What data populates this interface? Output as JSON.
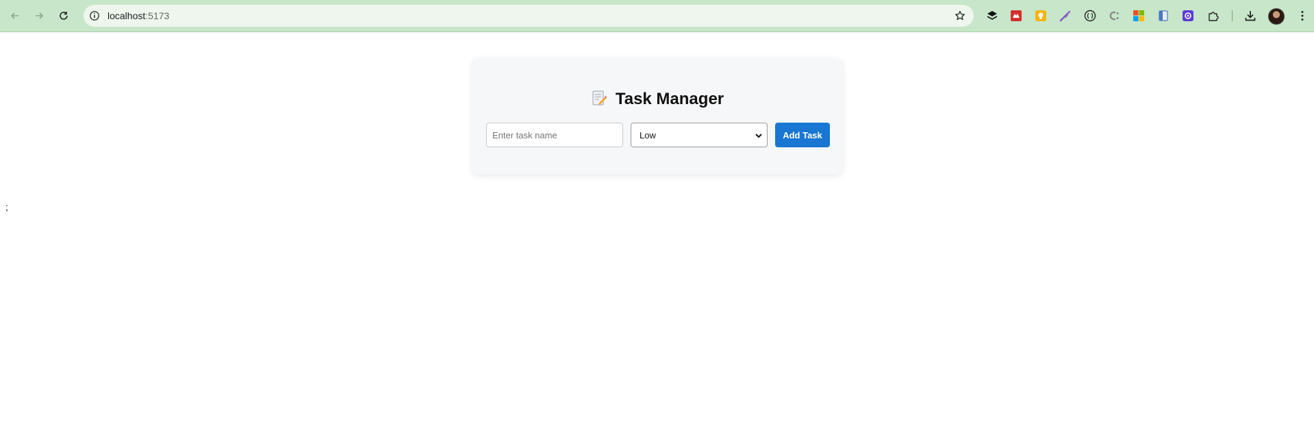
{
  "browser": {
    "url_host": "localhost",
    "url_port": ":5173",
    "extensions": [
      "layers-extension-icon",
      "red-shield-extension-icon",
      "yellow-bulb-extension-icon",
      "purple-feather-extension-icon",
      "code-braces-extension-icon",
      "cg-extension-icon",
      "microsoft-extension-icon",
      "clipboard-extension-icon",
      "purple-gear-extension-icon",
      "puzzle-extensions-icon"
    ]
  },
  "app": {
    "title": "Task Manager",
    "title_icon": "memo-icon",
    "task_input": {
      "value": "",
      "placeholder": "Enter task name"
    },
    "priority_select": {
      "selected": "Low"
    },
    "add_button_label": "Add Task"
  },
  "page": {
    "stray_text": ";"
  }
}
